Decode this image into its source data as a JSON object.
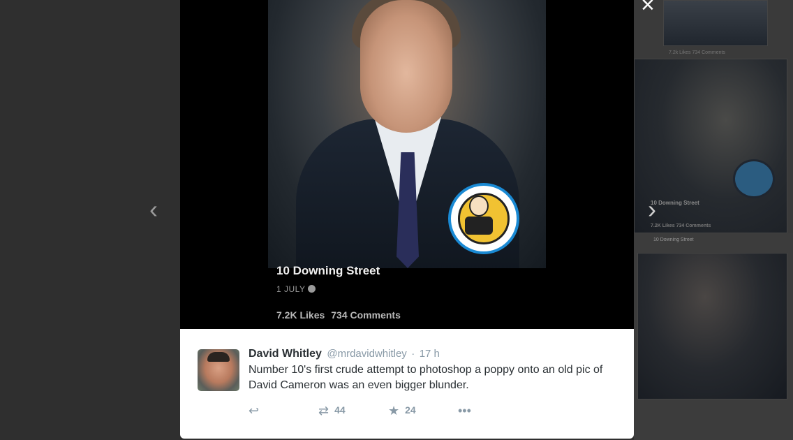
{
  "lightbox": {
    "close_icon": "close-icon",
    "prev_icon": "chevron-left-icon",
    "next_icon": "chevron-right-icon",
    "close_glyph": "×",
    "prev_glyph": "‹",
    "next_glyph": "›"
  },
  "background": {
    "tile_caption_top": "7.2k Likes  734 Comments",
    "tile_title": "10 Downing Street",
    "tile_caption_mid": "7.2K Likes  734 Comments",
    "tile_post_author": "10 Downing Street"
  },
  "photo_caption": {
    "title": "10 Downing Street",
    "date": "1 JULY",
    "likes": "7.2K Likes",
    "comments": "734 Comments"
  },
  "tweet": {
    "name": "David Whitley",
    "handle": "@mrdavidwhitley",
    "separator": "·",
    "time": "17 h",
    "text": "Number 10's first crude attempt to photoshop a poppy onto an old pic of David Cameron was an even bigger  blunder.",
    "actions": {
      "reply_glyph": "↩",
      "retweet_glyph": "⇄",
      "retweet_count": "44",
      "favorite_glyph": "★",
      "favorite_count": "24",
      "more_glyph": "•••"
    }
  },
  "colors": {
    "tweet_name": "#292f33",
    "tweet_meta": "#8899a6",
    "badge_ring": "#1a8ad4"
  }
}
